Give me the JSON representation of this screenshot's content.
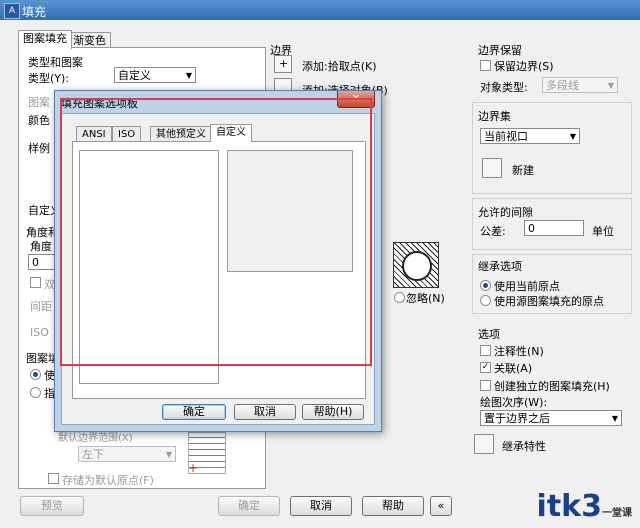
{
  "window": {
    "title": "填充"
  },
  "tabs": [
    "图案填充",
    "渐变色"
  ],
  "left": {
    "type_pattern_group": "类型和图案",
    "type_label": "类型(Y):",
    "type_value": "自定义",
    "pattern_label": "图案",
    "color_label": "颜色",
    "sample_label": "样例",
    "custom_label": "自定义",
    "angle_group": "角度和",
    "angle_label": "角度",
    "angle_value": "0",
    "double_label": "双",
    "spacing_label": "间距",
    "iso_label": "ISO",
    "origin_group": "图案填",
    "use_label": "使",
    "specify_label": "指",
    "store_label": "默认边界范围(X)",
    "position_value": "左下",
    "store_default_label": "存储为默认原点(F)"
  },
  "boundaries": {
    "title": "边界",
    "add_pick": "添加:拾取点(K)",
    "add_select": "添加:选择对象(B)"
  },
  "ignore_label": "忽略(N)",
  "right": {
    "retain_group": "边界保留",
    "retain_label": "保留边界(S)",
    "object_type_label": "对象类型:",
    "object_type_value": "多段线",
    "boundary_set_group": "边界集",
    "boundary_set_value": "当前视口",
    "new_label": "新建",
    "gap_group": "允许的间隙",
    "tolerance_label": "公差:",
    "tolerance_value": "0",
    "unit_label": "单位",
    "inherit_group": "继承选项",
    "inherit_current": "使用当前原点",
    "inherit_source": "使用源图案填充的原点",
    "options_group": "选项",
    "annotative": "注释性(N)",
    "associative": "关联(A)",
    "separate": "创建独立的图案填充(H)",
    "draw_order_label": "绘图次序(W):",
    "draw_order_value": "置于边界之后",
    "inherit_props": "继承特性"
  },
  "bottom": {
    "preview": "预览",
    "ok": "确定",
    "cancel": "取消",
    "help": "帮助"
  },
  "dialog": {
    "title": "填充图案选项板",
    "close": "×",
    "tabs": [
      "ANSI",
      "ISO",
      "其他预定义",
      "自定义"
    ],
    "ok": "确定",
    "cancel": "取消",
    "help": "帮助(H)"
  },
  "watermark": {
    "text": "itk3",
    "sub": "一堂课"
  },
  "colors": {
    "title_bar": "#2f6fb3",
    "highlight_rect": "#e03b47",
    "watermark": "#1a3f8f"
  }
}
